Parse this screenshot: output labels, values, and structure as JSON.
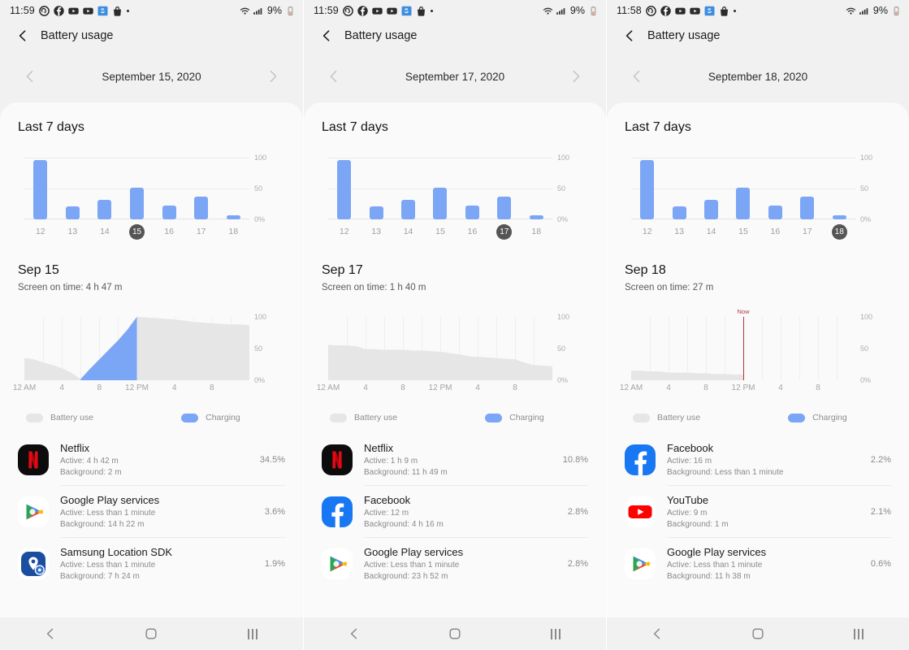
{
  "app": {
    "title": "Battery usage"
  },
  "icons": {
    "back": "back-chevron-icon",
    "prev": "chevron-left-icon",
    "next": "chevron-right-icon",
    "wifi": "wifi-icon",
    "signal": "cellular-signal-icon",
    "battery": "battery-low-icon",
    "home": "home-icon",
    "recents": "recent-apps-icon"
  },
  "legend": {
    "battery_use": "Battery use",
    "charging": "Charging"
  },
  "section": {
    "week_title": "Last 7 days"
  },
  "colors": {
    "bar_blue": "#7ba6f5",
    "area_gray": "#e6e6e6",
    "now_red": "#b3343f",
    "selected_pill": "#555555",
    "page_bg": "#f1f1f1",
    "card_bg": "#fafafa"
  },
  "screens": [
    {
      "statusbar": {
        "time": "11:59",
        "battery_percent": "9%",
        "notifications": [
          "threads-icon",
          "facebook-icon",
          "youtube-icon",
          "youtube-music-icon",
          "samsung-app-icon",
          "shopping-bag-icon",
          "more-dot-icon"
        ]
      },
      "date": "September 15, 2020",
      "has_next": true,
      "has_prev": true,
      "day_title": "Sep 15",
      "screen_on_time": "Screen on time: 4 h 47 m",
      "chart_data": [
        {
          "type": "bar",
          "title": "Last 7 days",
          "categories": [
            "12",
            "13",
            "14",
            "15",
            "16",
            "17",
            "18"
          ],
          "values": [
            96,
            21,
            32,
            51,
            22,
            37,
            7
          ],
          "selected": "15",
          "ylabel": "",
          "xlabel": "",
          "ylim": [
            0,
            100
          ],
          "yticks": [
            "100",
            "50",
            "0%"
          ],
          "grid": true
        },
        {
          "type": "area",
          "title": "Sep 15",
          "xlabel": "",
          "ylabel": "",
          "xticks": [
            "12 AM",
            "4",
            "8",
            "12 PM",
            "4",
            "8"
          ],
          "yticks": [
            "100",
            "50",
            "0%"
          ],
          "ylim": [
            0,
            100
          ],
          "x_hours": [
            0,
            1,
            2,
            3,
            4,
            5,
            6,
            7,
            8,
            9,
            10,
            11,
            12,
            13,
            14,
            15,
            16,
            17,
            18,
            19,
            20,
            21,
            22,
            23,
            24
          ],
          "battery_percent": [
            35,
            33,
            28,
            24,
            19,
            12,
            2,
            18,
            33,
            48,
            63,
            80,
            100,
            99,
            98,
            97,
            96,
            94,
            92,
            91,
            90,
            89,
            88,
            88,
            87
          ],
          "charging_from_hour": 6,
          "charging_to_hour": 12,
          "now_marker": null,
          "grid": true
        }
      ],
      "apps": [
        {
          "name": "Netflix",
          "icon": "netflix-icon",
          "active": "Active: 4 h 42 m",
          "background": "Background: 2 m",
          "percent": "34.5%"
        },
        {
          "name": "Google Play services",
          "icon": "google-play-services-icon",
          "active": "Active: Less than 1 minute",
          "background": "Background: 14 h 22 m",
          "percent": "3.6%"
        },
        {
          "name": "Samsung Location SDK",
          "icon": "samsung-location-sdk-icon",
          "active": "Active: Less than 1 minute",
          "background": "Background: 7 h 24 m",
          "percent": "1.9%"
        }
      ]
    },
    {
      "statusbar": {
        "time": "11:59",
        "battery_percent": "9%",
        "notifications": [
          "threads-icon",
          "facebook-icon",
          "youtube-icon",
          "youtube-music-icon",
          "samsung-app-icon",
          "shopping-bag-icon",
          "more-dot-icon"
        ]
      },
      "date": "September 17, 2020",
      "has_next": true,
      "has_prev": true,
      "day_title": "Sep 17",
      "screen_on_time": "Screen on time: 1 h 40 m",
      "chart_data": [
        {
          "type": "bar",
          "title": "Last 7 days",
          "categories": [
            "12",
            "13",
            "14",
            "15",
            "16",
            "17",
            "18"
          ],
          "values": [
            96,
            21,
            32,
            51,
            22,
            37,
            7
          ],
          "selected": "17",
          "ylabel": "",
          "xlabel": "",
          "ylim": [
            0,
            100
          ],
          "yticks": [
            "100",
            "50",
            "0%"
          ],
          "grid": true
        },
        {
          "type": "area",
          "title": "Sep 17",
          "xlabel": "",
          "ylabel": "",
          "xticks": [
            "12 AM",
            "4",
            "8",
            "12 PM",
            "4",
            "8"
          ],
          "yticks": [
            "100",
            "50",
            "0%"
          ],
          "ylim": [
            0,
            100
          ],
          "x_hours": [
            0,
            1,
            2,
            3,
            4,
            5,
            6,
            7,
            8,
            9,
            10,
            11,
            12,
            13,
            14,
            15,
            16,
            17,
            18,
            19,
            20,
            21,
            22,
            23,
            24
          ],
          "battery_percent": [
            56,
            55,
            55,
            54,
            49,
            49,
            48,
            48,
            48,
            47,
            47,
            46,
            45,
            43,
            41,
            38,
            37,
            36,
            35,
            34,
            33,
            28,
            24,
            23,
            22
          ],
          "charging_from_hour": null,
          "charging_to_hour": null,
          "now_marker": null,
          "grid": true
        }
      ],
      "apps": [
        {
          "name": "Netflix",
          "icon": "netflix-icon",
          "active": "Active: 1 h 9 m",
          "background": "Background: 11 h 49 m",
          "percent": "10.8%"
        },
        {
          "name": "Facebook",
          "icon": "facebook-icon",
          "active": "Active: 12 m",
          "background": "Background: 4 h 16 m",
          "percent": "2.8%"
        },
        {
          "name": "Google Play services",
          "icon": "google-play-services-icon",
          "active": "Active: Less than 1 minute",
          "background": "Background: 23 h 52 m",
          "percent": "2.8%"
        }
      ]
    },
    {
      "statusbar": {
        "time": "11:58",
        "battery_percent": "9%",
        "notifications": [
          "threads-icon",
          "facebook-icon",
          "youtube-icon",
          "youtube-music-icon",
          "samsung-app-icon",
          "shopping-bag-icon",
          "more-dot-icon"
        ]
      },
      "date": "September 18, 2020",
      "has_next": false,
      "has_prev": true,
      "day_title": "Sep 18",
      "screen_on_time": "Screen on time: 27 m",
      "chart_data": [
        {
          "type": "bar",
          "title": "Last 7 days",
          "categories": [
            "12",
            "13",
            "14",
            "15",
            "16",
            "17",
            "18"
          ],
          "values": [
            96,
            21,
            32,
            51,
            22,
            37,
            7
          ],
          "selected": "18",
          "ylabel": "",
          "xlabel": "",
          "ylim": [
            0,
            100
          ],
          "yticks": [
            "100",
            "50",
            "0%"
          ],
          "grid": true
        },
        {
          "type": "area",
          "title": "Sep 18",
          "xlabel": "",
          "ylabel": "",
          "xticks": [
            "12 AM",
            "4",
            "8",
            "12 PM",
            "4",
            "8"
          ],
          "yticks": [
            "100",
            "50",
            "0%"
          ],
          "ylim": [
            0,
            100
          ],
          "x_hours": [
            0,
            1,
            2,
            3,
            4,
            5,
            6,
            7,
            8,
            9,
            10,
            11,
            12
          ],
          "battery_percent": [
            15,
            15,
            14,
            14,
            12,
            12,
            12,
            11,
            11,
            10,
            10,
            9,
            9
          ],
          "charging_from_hour": null,
          "charging_to_hour": null,
          "now_marker": {
            "label": "Now",
            "hour": 12
          },
          "grid": true
        }
      ],
      "apps": [
        {
          "name": "Facebook",
          "icon": "facebook-icon",
          "active": "Active: 16 m",
          "background": "Background: Less than 1 minute",
          "percent": "2.2%"
        },
        {
          "name": "YouTube",
          "icon": "youtube-icon",
          "active": "Active: 9 m",
          "background": "Background: 1 m",
          "percent": "2.1%"
        },
        {
          "name": "Google Play services",
          "icon": "google-play-services-icon",
          "active": "Active: Less than 1 minute",
          "background": "Background: 11 h 38 m",
          "percent": "0.6%"
        }
      ]
    }
  ]
}
